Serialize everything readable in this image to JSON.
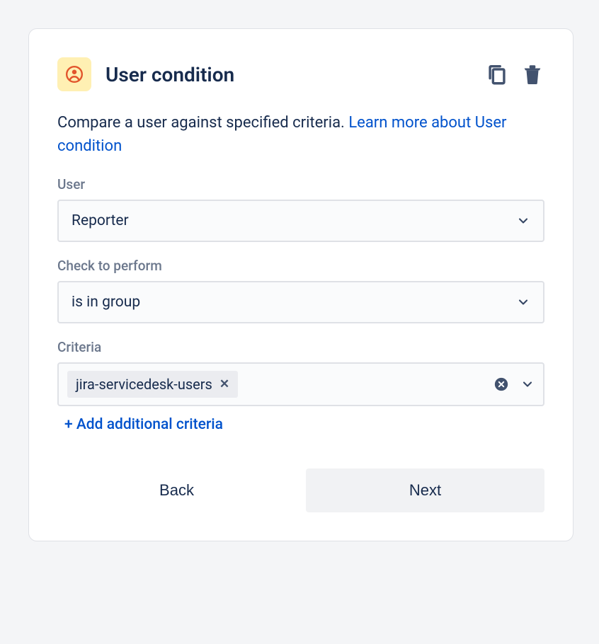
{
  "header": {
    "title": "User condition",
    "icon": "user-condition-icon"
  },
  "description": {
    "text": "Compare a user against specified criteria. ",
    "link": "Learn more about User condition"
  },
  "fields": {
    "user": {
      "label": "User",
      "value": "Reporter"
    },
    "check": {
      "label": "Check to perform",
      "value": "is in group"
    },
    "criteria": {
      "label": "Criteria",
      "tags": [
        "jira-servicedesk-users"
      ],
      "add_label": "+ Add additional criteria"
    }
  },
  "footer": {
    "back": "Back",
    "next": "Next"
  }
}
